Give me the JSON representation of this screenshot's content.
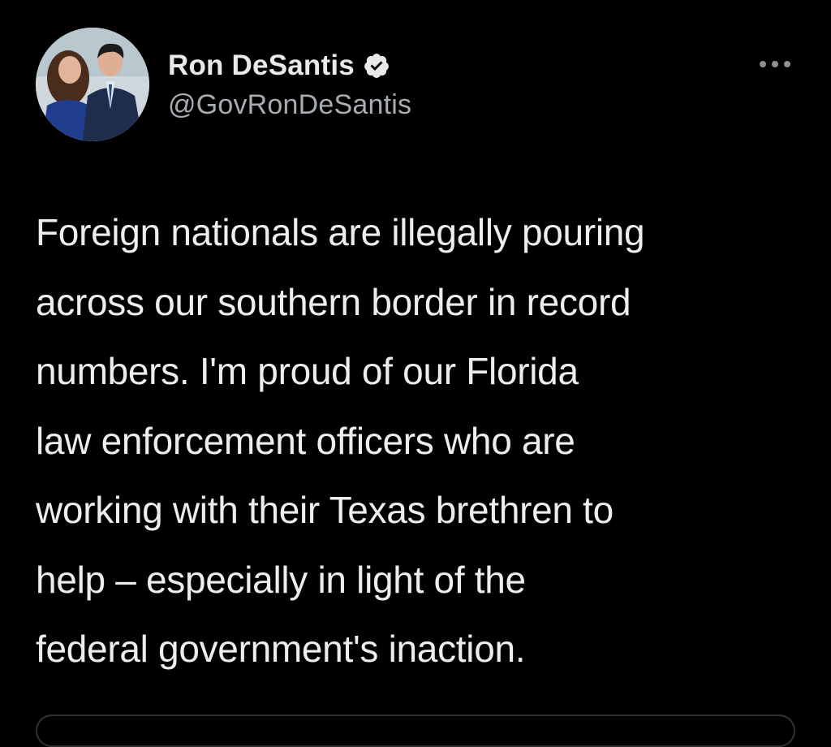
{
  "tweet": {
    "author": {
      "display_name": "Ron DeSantis",
      "handle": "@GovRonDeSantis",
      "verified": true,
      "avatar_icon": "profile-photo"
    },
    "more_icon": "ellipsis-icon",
    "text_lines": [
      "Foreign nationals are illegally pouring",
      "across our southern border in record",
      "numbers. I'm proud of our Florida",
      "law enforcement officers who are",
      "working with their Texas brethren to",
      "help – especially in light of the",
      "federal government's inaction."
    ]
  },
  "colors": {
    "background": "#000000",
    "primary_text": "#e7e9ea",
    "secondary_text": "#a6acb1",
    "verified_badge": "#e7e9ea"
  }
}
